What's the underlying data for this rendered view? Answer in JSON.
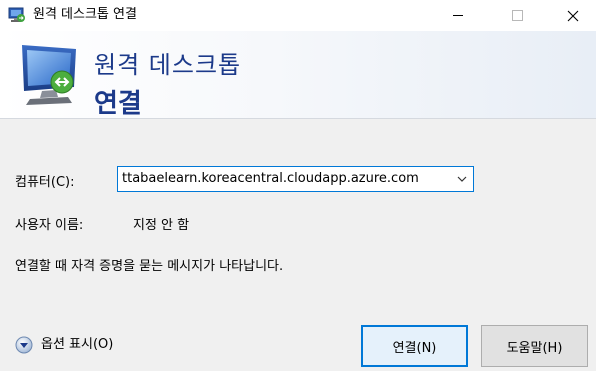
{
  "window": {
    "title": "원격 데스크톱 연결"
  },
  "banner": {
    "line1": "원격 데스크톱",
    "line2": "연결"
  },
  "form": {
    "computer_label": "컴퓨터(C):",
    "computer_value": "ttabaelearn.koreacentral.cloudapp.azure.com",
    "username_label": "사용자 이름:",
    "username_value": "지정 안 함",
    "info_text": "연결할 때 자격 증명을 묻는 메시지가 나타납니다."
  },
  "footer": {
    "options_label": "옵션 표시(O)",
    "connect_label": "연결(N)",
    "help_label": "도움말(H)"
  },
  "colors": {
    "accent": "#0078d7",
    "banner_text": "#1c3a8a"
  }
}
